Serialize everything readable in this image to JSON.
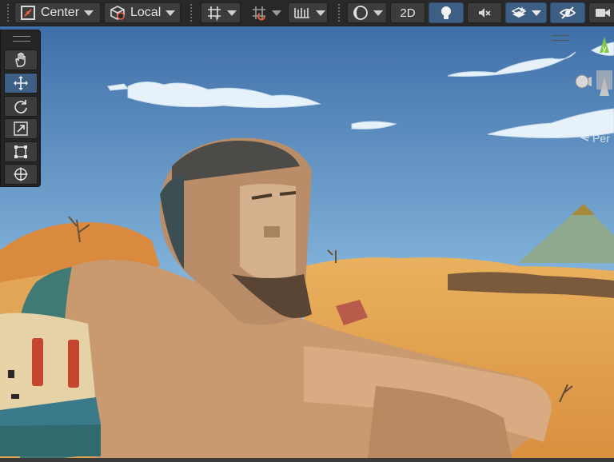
{
  "toolbar": {
    "pivot_mode": "Center",
    "pivot_rotation": "Local",
    "mode_2d": "2D"
  },
  "scene_view": {
    "projection_label": "Per"
  },
  "colors": {
    "toolbar_bg": "#282828",
    "button_bg": "#3c3c3c",
    "active_accent": "#3d5f86",
    "sky_top": "#3f6fa8",
    "sand": "#e3a857"
  },
  "tools": [
    "hand-tool",
    "move-tool",
    "rotate-tool",
    "scale-tool",
    "rect-tool",
    "transform-tool"
  ],
  "active_tool": "move-tool"
}
